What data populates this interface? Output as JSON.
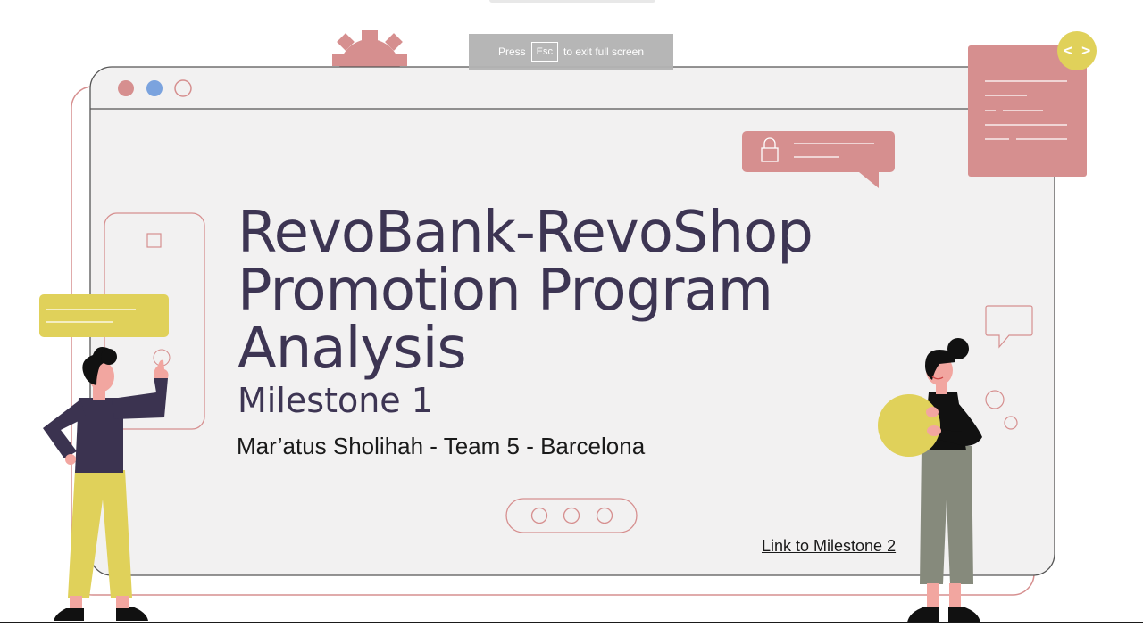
{
  "banner": {
    "press": "Press",
    "key": "Esc",
    "suffix": "to exit full screen"
  },
  "slide": {
    "title_lines": [
      "RevoBank-RevoShop",
      "Promotion Program",
      "Analysis"
    ],
    "subtitle": "Milestone 1",
    "author": "Mar’atus Sholihah - Team 5 - Barcelona",
    "link_text": "Link to Milestone 2",
    "code_badge": "< >"
  },
  "colors": {
    "title": "#3d3553",
    "pink": "#d68f8f",
    "yellow": "#e0d15a",
    "blue": "#7ba3de",
    "panel": "#f2f1f1",
    "dark_purple": "#3b3350",
    "olive": "#868a7c"
  }
}
